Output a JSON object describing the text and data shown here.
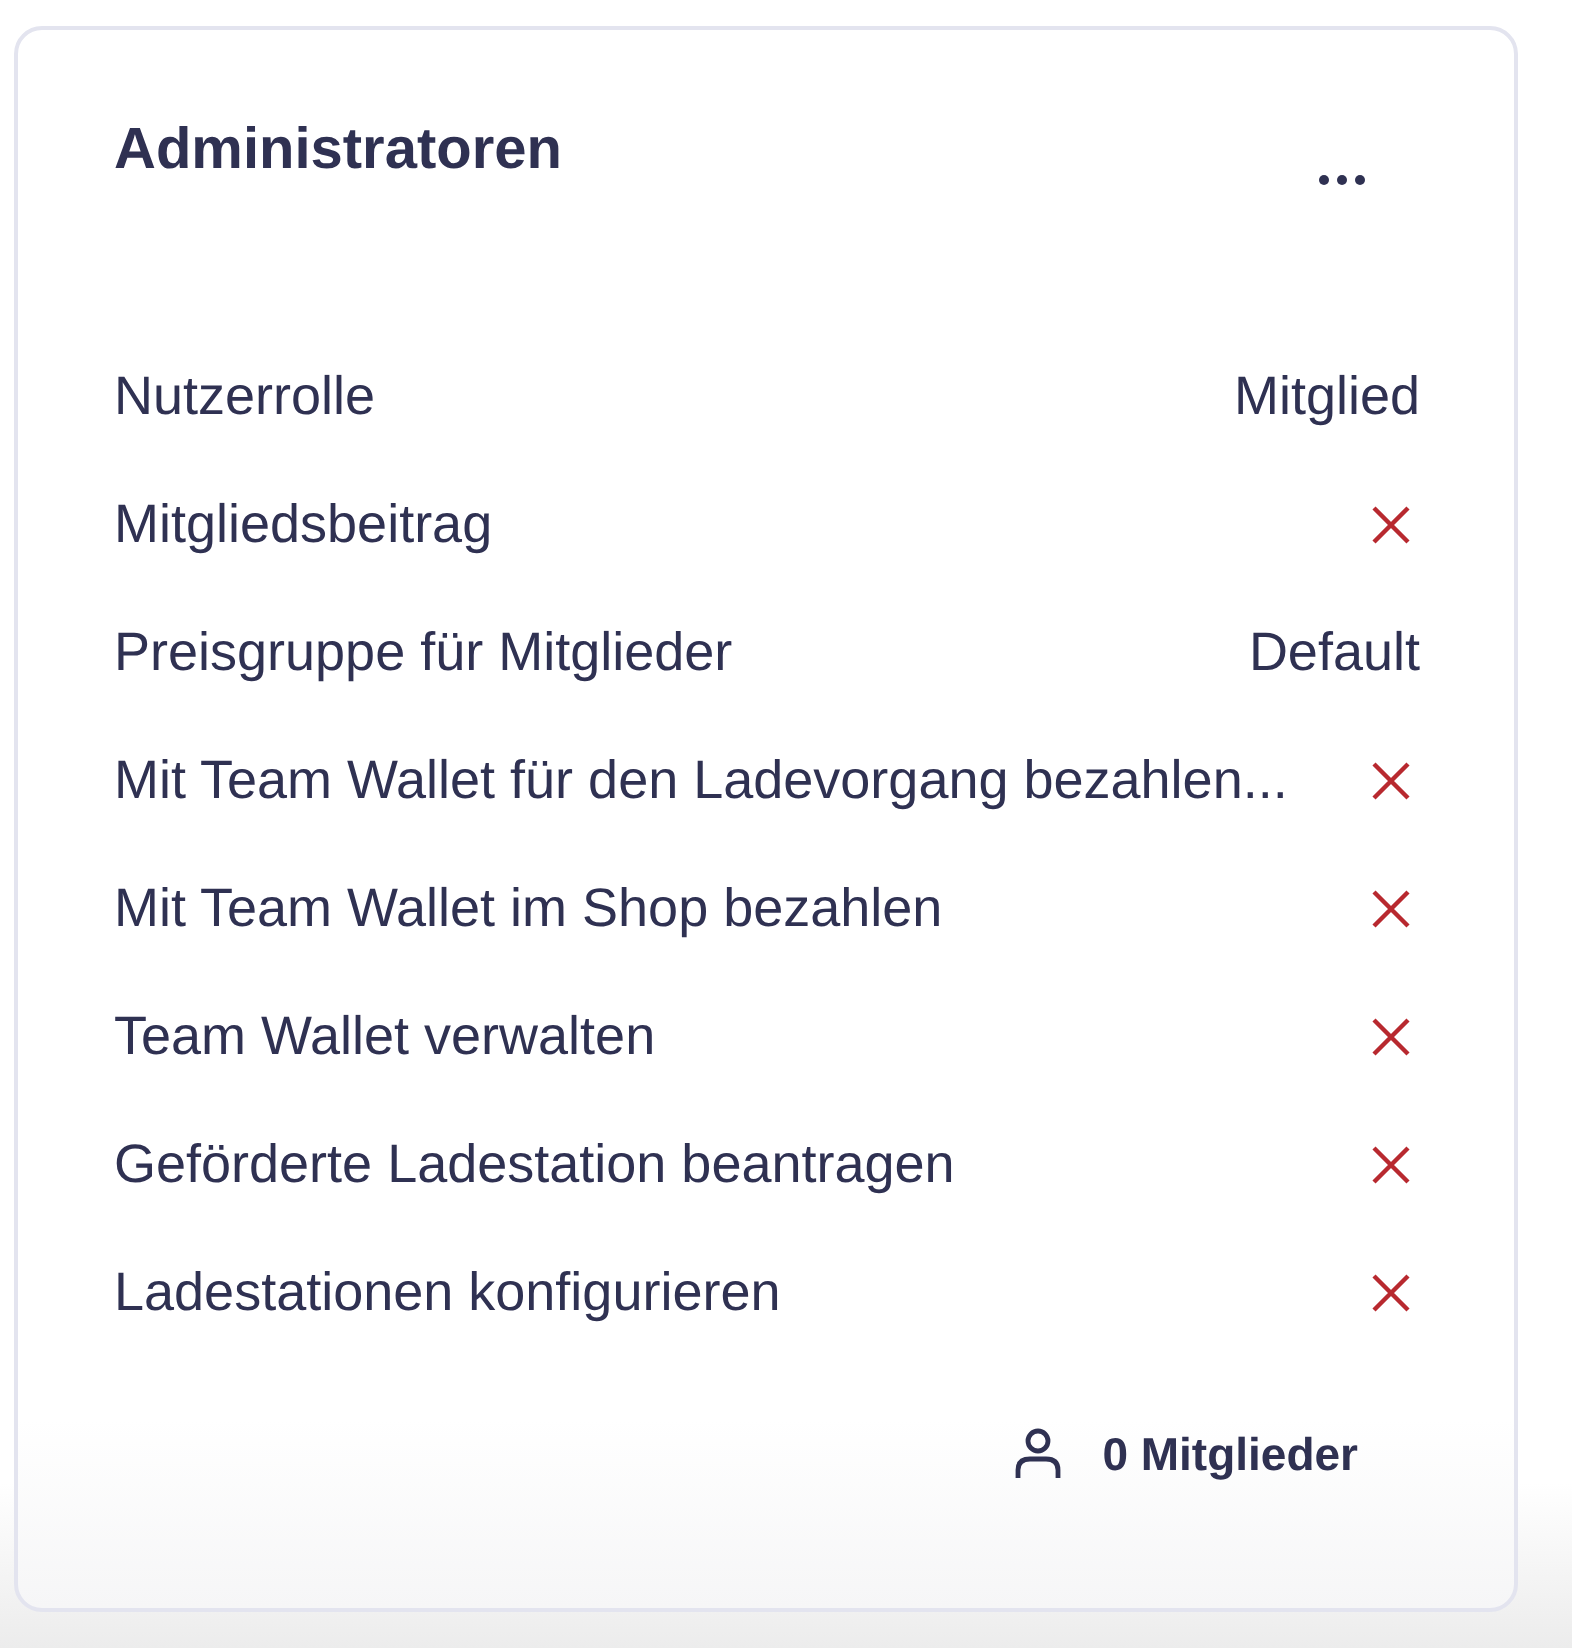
{
  "card": {
    "title": "Administratoren",
    "rows": [
      {
        "label": "Nutzerrolle",
        "kind": "value",
        "value": "Mitglied"
      },
      {
        "label": "Mitgliedsbeitrag",
        "kind": "flag",
        "enabled": false
      },
      {
        "label": "Preisgruppe für Mitglieder",
        "kind": "value",
        "value": "Default"
      },
      {
        "label": "Mit Team Wallet für den Ladevorgang bezahlen...",
        "kind": "flag",
        "enabled": false
      },
      {
        "label": "Mit Team Wallet im Shop bezahlen",
        "kind": "flag",
        "enabled": false
      },
      {
        "label": "Team Wallet verwalten",
        "kind": "flag",
        "enabled": false
      },
      {
        "label": "Geförderte Ladestation beantragen",
        "kind": "flag",
        "enabled": false
      },
      {
        "label": "Ladestationen konfigurieren",
        "kind": "flag",
        "enabled": false
      }
    ],
    "footer": {
      "member_count": "0 Mitglieder"
    }
  }
}
